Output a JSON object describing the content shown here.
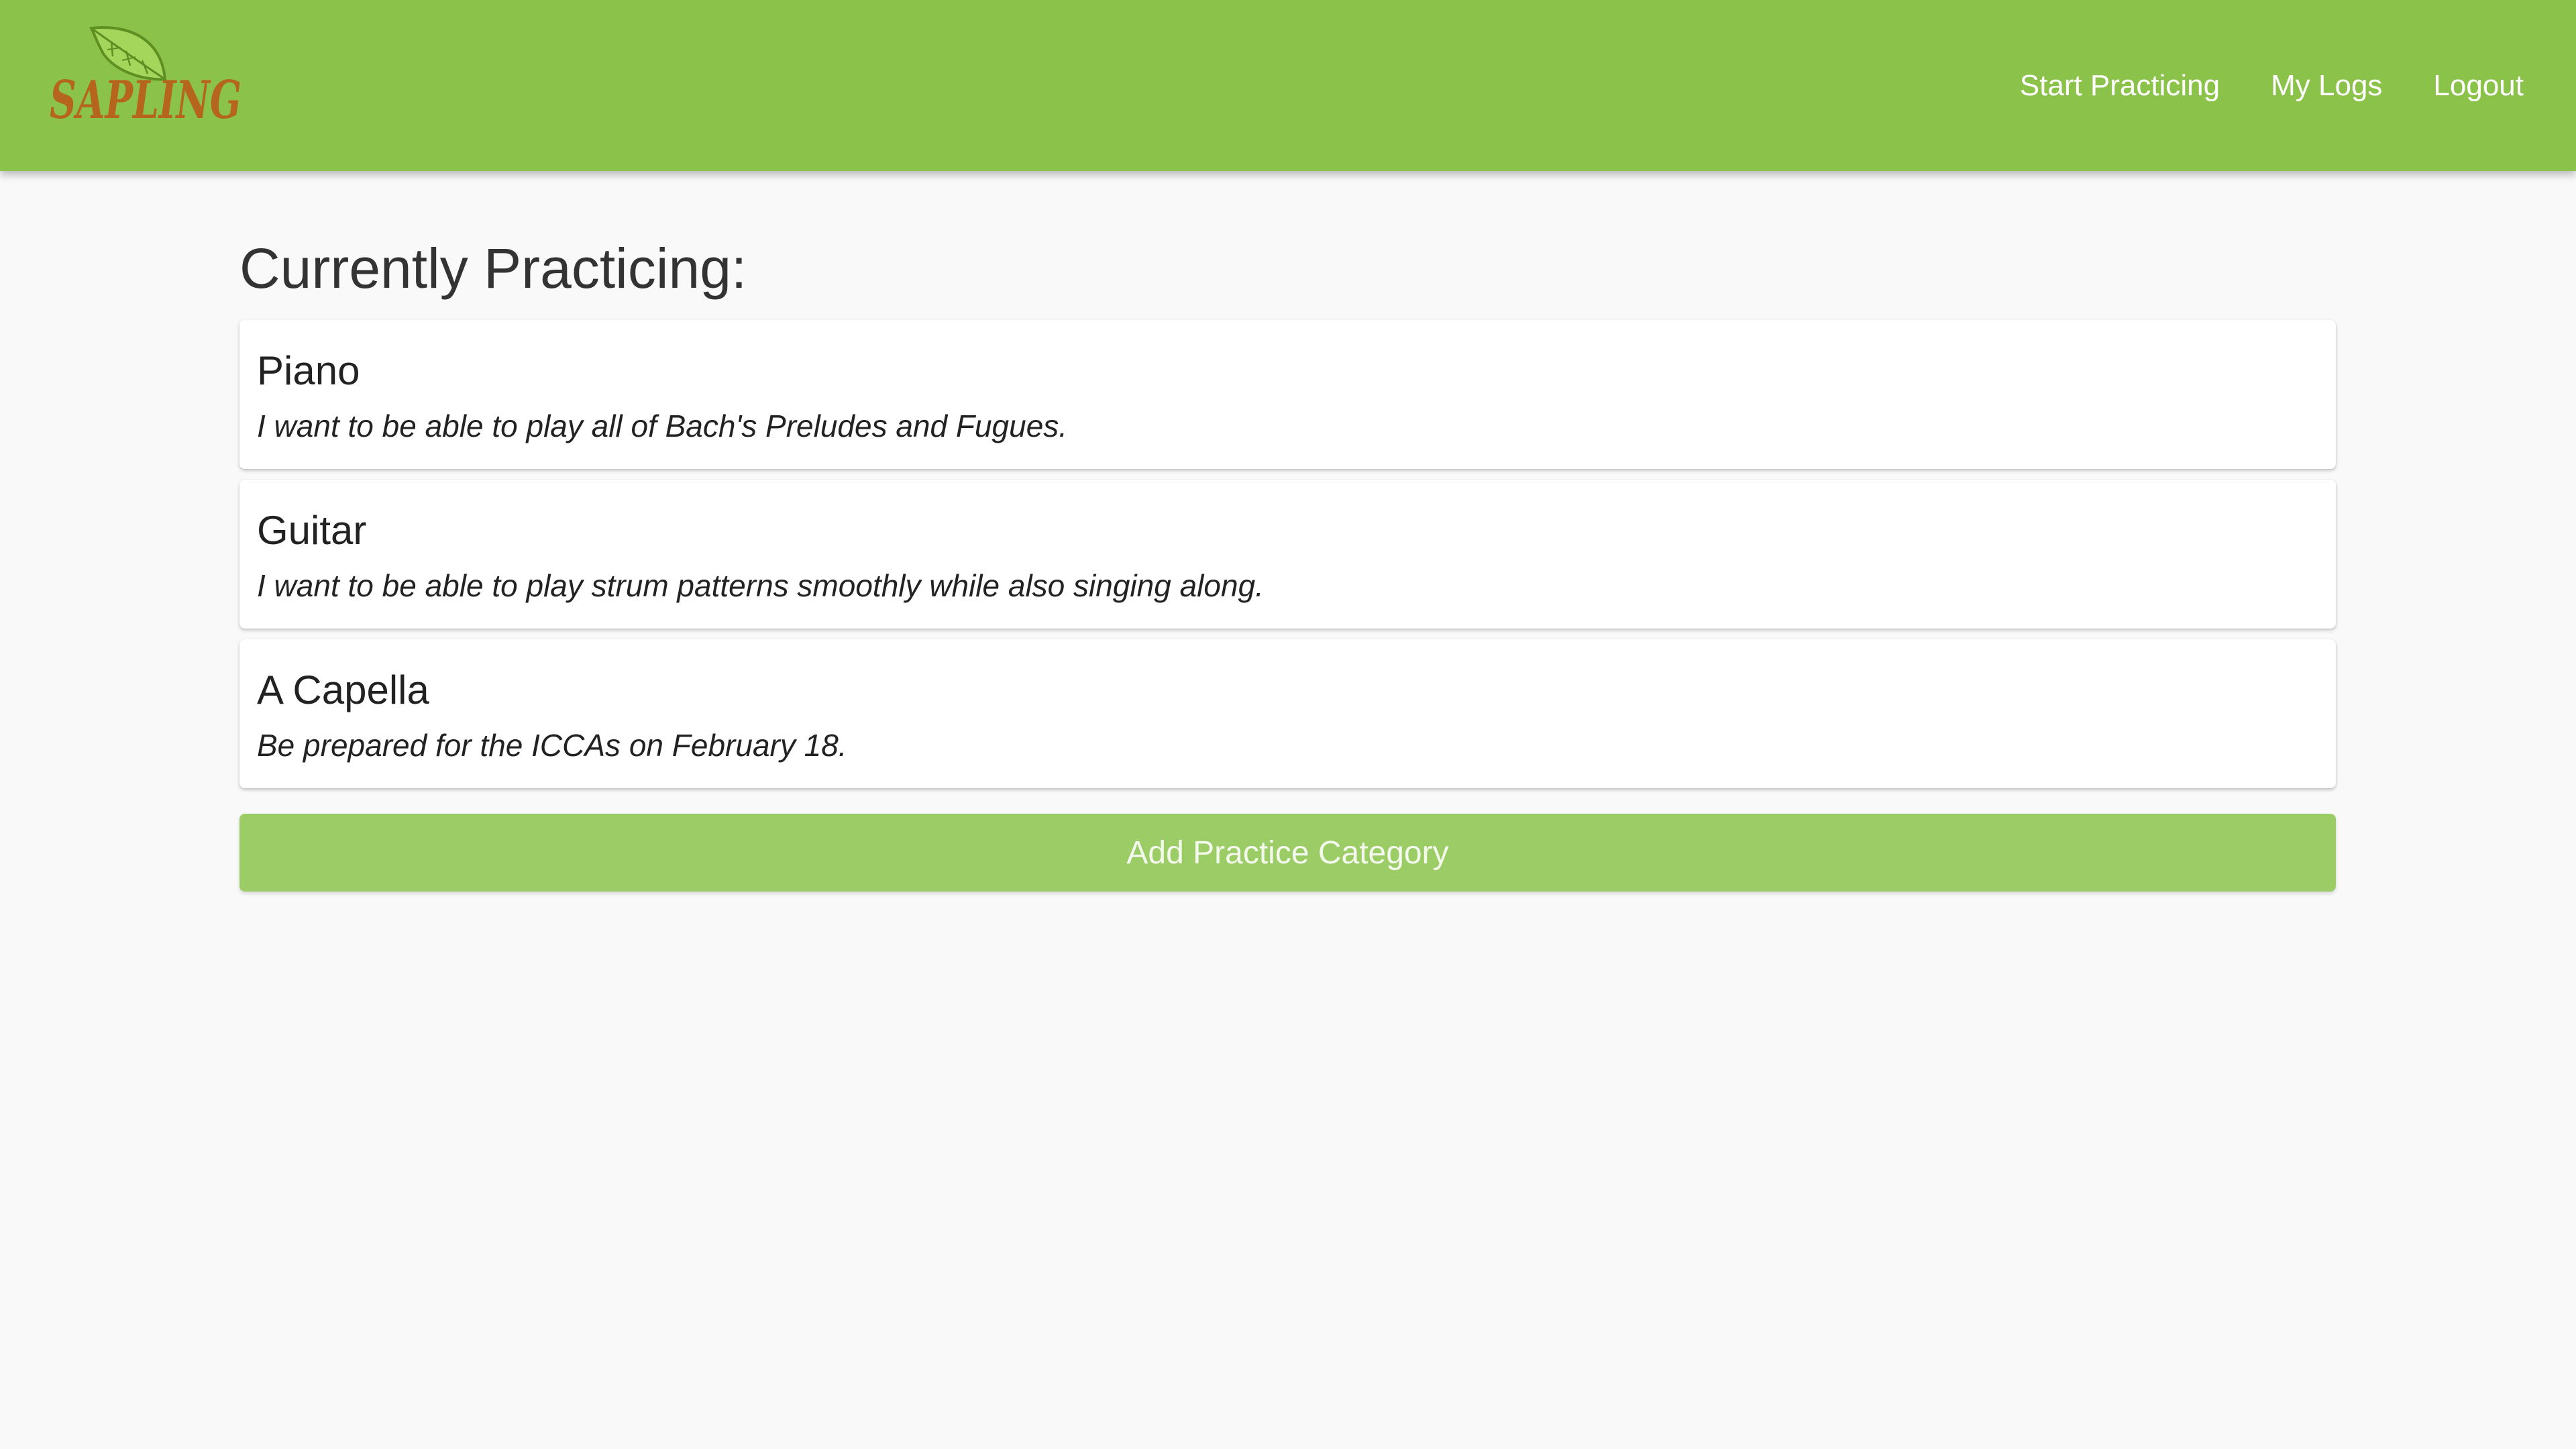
{
  "brand": {
    "name": "SAPLING",
    "icon": "leaf-icon",
    "text_color": "#b5651d",
    "leaf_color": "#8bc34a"
  },
  "nav": {
    "items": [
      {
        "label": "Start Practicing"
      },
      {
        "label": "My Logs"
      },
      {
        "label": "Logout"
      }
    ]
  },
  "main": {
    "title": "Currently Practicing:",
    "categories": [
      {
        "title": "Piano",
        "description": "I want to be able to play all of Bach's Preludes and Fugues."
      },
      {
        "title": "Guitar",
        "description": "I want to be able to play strum patterns smoothly while also singing along."
      },
      {
        "title": "A Capella",
        "description": "Be prepared for the ICCAs on February 18."
      }
    ],
    "add_button_label": "Add Practice Category"
  },
  "colors": {
    "navbar": "#8bc34a",
    "button": "#9ccc65",
    "background": "#f9f9f9"
  }
}
